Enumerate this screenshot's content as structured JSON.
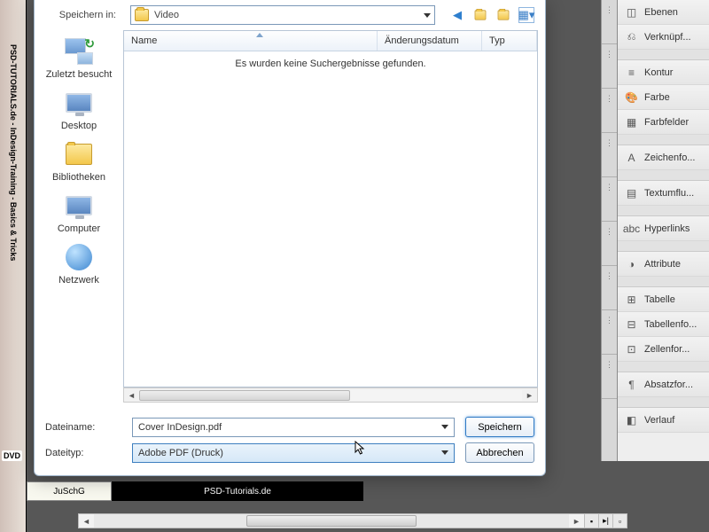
{
  "leftstrip": {
    "rot": "PSD-TUTORIALS.de - InDesign-Training - Basics & Tricks",
    "dvd": "DVD"
  },
  "bottombar": {
    "pale": "JuSchG",
    "dark": "PSD-Tutorials.de"
  },
  "dialog": {
    "save_in_label": "Speichern in:",
    "location": "Video",
    "toolbar": {
      "back": "◄",
      "up": "↑",
      "new": "✦",
      "views": "▦"
    },
    "columns": {
      "name": "Name",
      "modified": "Änderungsdatum",
      "type": "Typ"
    },
    "empty_msg": "Es wurden keine Suchergebnisse gefunden.",
    "filename_label": "Dateiname:",
    "filename": "Cover InDesign.pdf",
    "filetype_label": "Dateityp:",
    "filetype": "Adobe PDF (Druck)",
    "save_btn": "Speichern",
    "cancel_btn": "Abbrechen"
  },
  "places": {
    "recent": "Zuletzt besucht",
    "desktop": "Desktop",
    "libraries": "Bibliotheken",
    "computer": "Computer",
    "network": "Netzwerk"
  },
  "panels": [
    {
      "icon": "◫",
      "label": "Ebenen"
    },
    {
      "icon": "⎌",
      "label": "Verknüpf..."
    },
    {
      "gap": true
    },
    {
      "icon": "≡",
      "label": "Kontur"
    },
    {
      "icon": "🎨",
      "label": "Farbe"
    },
    {
      "icon": "▦",
      "label": "Farbfelder"
    },
    {
      "gap": true
    },
    {
      "icon": "A",
      "label": "Zeichenfo..."
    },
    {
      "gap": true
    },
    {
      "icon": "▤",
      "label": "Textumflu..."
    },
    {
      "gap": true
    },
    {
      "icon": "abc",
      "label": "Hyperlinks"
    },
    {
      "gap": true
    },
    {
      "icon": "◑",
      "label": "Attribute"
    },
    {
      "gap": true
    },
    {
      "icon": "⊞",
      "label": "Tabelle"
    },
    {
      "icon": "⊟",
      "label": "Tabellenfo..."
    },
    {
      "icon": "⊡",
      "label": "Zellenfor..."
    },
    {
      "gap": true
    },
    {
      "icon": "¶",
      "label": "Absatzfor..."
    },
    {
      "gap": true
    },
    {
      "icon": "◧",
      "label": "Verlauf"
    }
  ]
}
